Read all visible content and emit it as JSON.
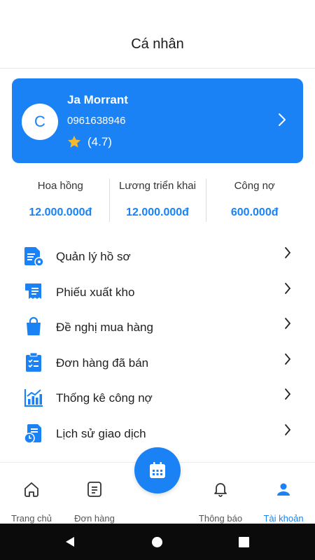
{
  "header": {
    "title": "Cá nhân"
  },
  "profile": {
    "avatar_letter": "C",
    "name": "Ja Morrant",
    "phone": "0961638946",
    "rating": "(4.7)"
  },
  "stats": [
    {
      "label": "Hoa hồng",
      "value": "12.000.000đ"
    },
    {
      "label": "Lương triển khai",
      "value": "12.000.000đ"
    },
    {
      "label": "Công nợ",
      "value": "600.000đ"
    }
  ],
  "menu": [
    {
      "label": "Quản lý hồ sơ",
      "icon": "profile-document-icon"
    },
    {
      "label": "Phiếu xuất kho",
      "icon": "receipt-icon"
    },
    {
      "label": "Đề nghị mua hàng",
      "icon": "shopping-bag-icon"
    },
    {
      "label": "Đơn hàng đã bán",
      "icon": "clipboard-check-icon"
    },
    {
      "label": "Thống kê công nợ",
      "icon": "chart-icon"
    },
    {
      "label": "Lịch sử giao dịch",
      "icon": "history-icon"
    }
  ],
  "bottom_nav": [
    {
      "label": "Trang chủ",
      "icon": "home-icon",
      "active": false
    },
    {
      "label": "Đơn hàng",
      "icon": "order-icon",
      "active": false
    },
    {
      "label": "Thông báo",
      "icon": "bell-icon",
      "active": false
    },
    {
      "label": "Tài khoản",
      "icon": "user-icon",
      "active": true
    }
  ],
  "colors": {
    "accent": "#1a82f4",
    "star": "#f5b82e"
  }
}
